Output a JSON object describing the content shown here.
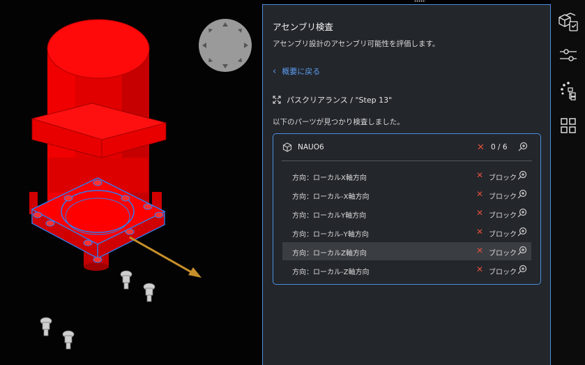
{
  "panel": {
    "title": "アセンブリ検査",
    "description": "アセンブリ設計のアセンブリ可能性を評価します。",
    "back_label": "概要に戻る",
    "section_label": "パスクリアランス / \"Step 13\"",
    "found_text": "以下のパーツが見つかり検査しました。",
    "part_name": "NAUO6",
    "count": "0 / 6",
    "rows": [
      {
        "direction": "方向：ローカルX軸方向",
        "status": "ブロック"
      },
      {
        "direction": "方向：ローカル-X軸方向",
        "status": "ブロック"
      },
      {
        "direction": "方向：ローカルY軸方向",
        "status": "ブロック"
      },
      {
        "direction": "方向：ローカル-Y軸方向",
        "status": "ブロック"
      },
      {
        "direction": "方向：ローカルZ軸方向",
        "status": "ブロック"
      },
      {
        "direction": "方向：ローカル-Z軸方向",
        "status": "ブロック"
      }
    ]
  },
  "sidebar": {
    "items": [
      {
        "icon": "assembly-check-icon",
        "active": true
      },
      {
        "icon": "sliders-icon",
        "active": false
      },
      {
        "icon": "structure-tree-icon",
        "active": false
      },
      {
        "icon": "grid-icon",
        "active": false
      }
    ]
  },
  "colors": {
    "accent": "#4a8fe0",
    "model_red": "#e00000",
    "error": "#e0503c",
    "panel_bg": "#23262b"
  }
}
